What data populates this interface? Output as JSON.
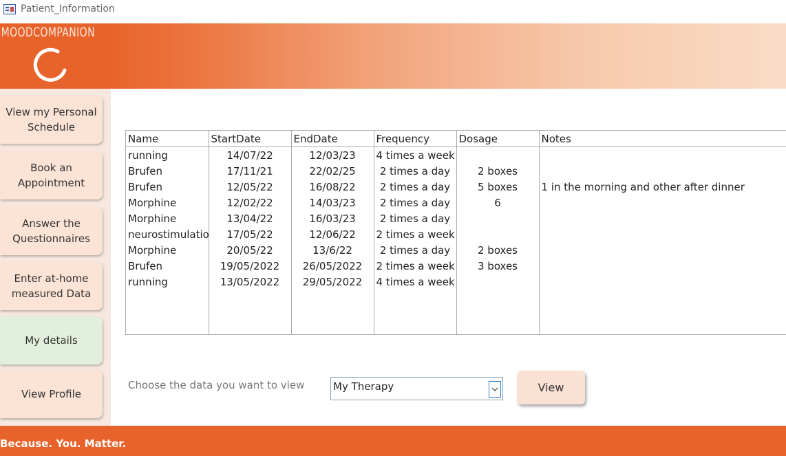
{
  "window": {
    "title": "Patient_Information"
  },
  "brand": {
    "name": "MOODCOMPANION",
    "tagline": "Because. You. Matter.",
    "accent": "#e8632b"
  },
  "nav": [
    {
      "label": "View my Personal Schedule"
    },
    {
      "label": "Book an Appointment"
    },
    {
      "label": "Answer the Questionnaires"
    },
    {
      "label": "Enter at-home measured Data"
    },
    {
      "label": "My details"
    },
    {
      "label": "View Profile"
    }
  ],
  "table": {
    "headers": [
      "Name",
      "StartDate",
      "EndDate",
      "Frequency",
      "Dosage",
      "Notes"
    ],
    "rows": [
      [
        "running",
        "14/07/22",
        "12/03/23",
        "4 times a week",
        "",
        ""
      ],
      [
        "Brufen",
        "17/11/21",
        "22/02/25",
        "2 times a day",
        "2 boxes",
        ""
      ],
      [
        "Brufen",
        "12/05/22",
        "16/08/22",
        "2 times a day",
        "5 boxes",
        "1 in the morning and other after dinner"
      ],
      [
        "Morphine",
        "12/02/22",
        "14/03/23",
        "2 times a day",
        "6",
        ""
      ],
      [
        "Morphine",
        "13/04/22",
        "16/03/23",
        "2 times a day",
        "",
        ""
      ],
      [
        "neurostimulatio",
        "17/05/22",
        "12/06/22",
        "2 times a week",
        "",
        ""
      ],
      [
        "Morphine",
        "20/05/22",
        "13/6/22",
        "2 times a day",
        "2 boxes",
        ""
      ],
      [
        "Brufen",
        "19/05/2022",
        "26/05/2022",
        "2 times a week",
        "3 boxes",
        ""
      ],
      [
        "running",
        "13/05/2022",
        "29/05/2022",
        "4 times a week",
        "",
        ""
      ]
    ]
  },
  "filter": {
    "label": "Choose the data you want to view",
    "selected": "My Therapy",
    "button": "View"
  }
}
